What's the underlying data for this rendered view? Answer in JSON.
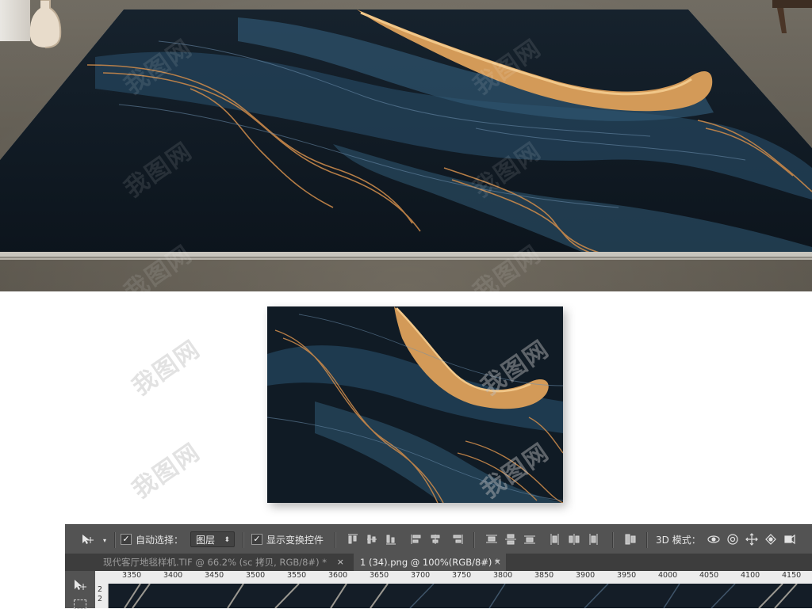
{
  "watermark_text": "我图网",
  "photoshop": {
    "toolbar": {
      "auto_select_label": "自动选择：",
      "auto_select_checked": true,
      "auto_select_target": "图层",
      "show_transform_label": "显示变换控件",
      "show_transform_checked": true,
      "mode_3d_label": "3D 模式："
    },
    "tabs": [
      {
        "label": "现代客厅地毯样机.TIF @ 66.2% (sc 拷贝, RGB/8#) *",
        "active": false
      },
      {
        "label": "1 (34).png @ 100%(RGB/8#) *",
        "active": true
      }
    ],
    "ruler_ticks": [
      "3350",
      "3400",
      "3450",
      "3500",
      "3550",
      "3600",
      "3650",
      "3700",
      "3750",
      "3800",
      "3850",
      "3900",
      "3950",
      "4000",
      "4050",
      "4100",
      "4150"
    ],
    "vruler_ticks": [
      "2",
      "2"
    ]
  },
  "colors": {
    "rug_navy": "#0f1a24",
    "gold": "#d49a5a",
    "teal": "#3b6a8a",
    "ps_panel": "#535353"
  }
}
